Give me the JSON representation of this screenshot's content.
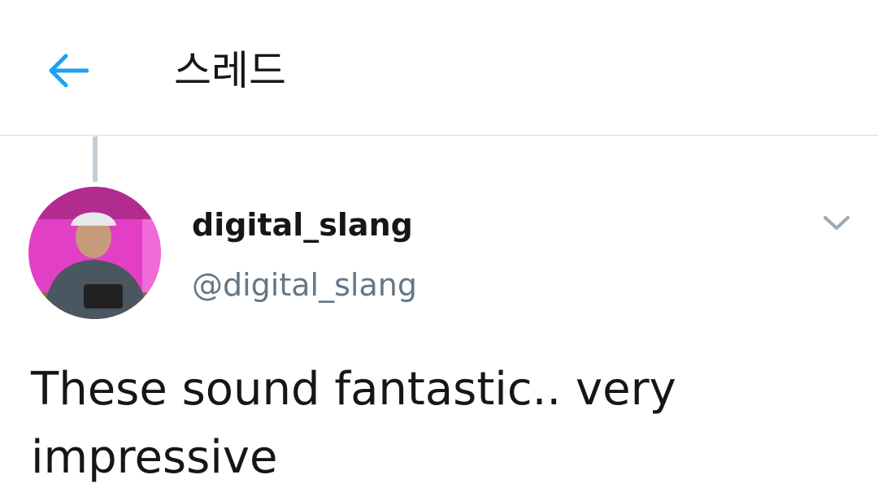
{
  "header": {
    "title": "스레드",
    "back_icon": "arrow-left-icon",
    "accent_color": "#1da1f2"
  },
  "tweet": {
    "author": {
      "display_name": "digital_slang",
      "handle": "@digital_slang",
      "avatar_icon": "avatar-photo"
    },
    "menu_icon": "chevron-down-icon",
    "text": "These sound fantastic.. very\nimpressive"
  },
  "colors": {
    "text_primary": "#14171a",
    "text_secondary": "#657786",
    "divider": "#d6dbdf",
    "thread_line": "#c3cfd8",
    "avatar_background": "#e23fc6"
  }
}
